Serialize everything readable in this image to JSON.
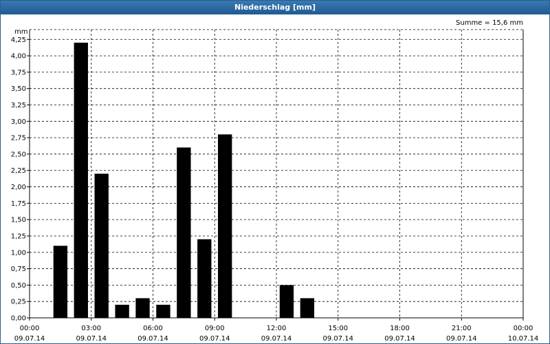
{
  "window": {
    "title": "Niederschlag [mm]"
  },
  "chart_data": {
    "type": "bar",
    "title": "Niederschlag [mm]",
    "ylabel": "mm",
    "summary": "Summe = 15,6 mm",
    "ylim": [
      0,
      4.4
    ],
    "grid": true,
    "y_ticks": [
      "0,00",
      "0,25",
      "0,50",
      "0,75",
      "1,00",
      "1,25",
      "1,50",
      "1,75",
      "2,00",
      "2,25",
      "2,50",
      "2,75",
      "3,00",
      "3,25",
      "3,50",
      "3,75",
      "4,00",
      "4,25"
    ],
    "x_ticks": [
      {
        "time": "00:00",
        "date": "09.07.14"
      },
      {
        "time": "03:00",
        "date": "09.07.14"
      },
      {
        "time": "06:00",
        "date": "09.07.14"
      },
      {
        "time": "09:00",
        "date": "09.07.14"
      },
      {
        "time": "12:00",
        "date": "09.07.14"
      },
      {
        "time": "15:00",
        "date": "09.07.14"
      },
      {
        "time": "18:00",
        "date": "09.07.14"
      },
      {
        "time": "21:00",
        "date": "09.07.14"
      },
      {
        "time": "00:00",
        "date": "10.07.14"
      }
    ],
    "x_range_hours": [
      0,
      24
    ],
    "bar_color": "#000000",
    "series": [
      {
        "hours": [
          1.5,
          2.5,
          3.5,
          4.5,
          5.5,
          6.5,
          7.5,
          8.5,
          9.5,
          12.5,
          13.5
        ],
        "values": [
          1.1,
          4.2,
          2.2,
          0.2,
          0.3,
          0.2,
          2.6,
          1.2,
          2.8,
          0.5,
          0.3
        ]
      }
    ]
  }
}
